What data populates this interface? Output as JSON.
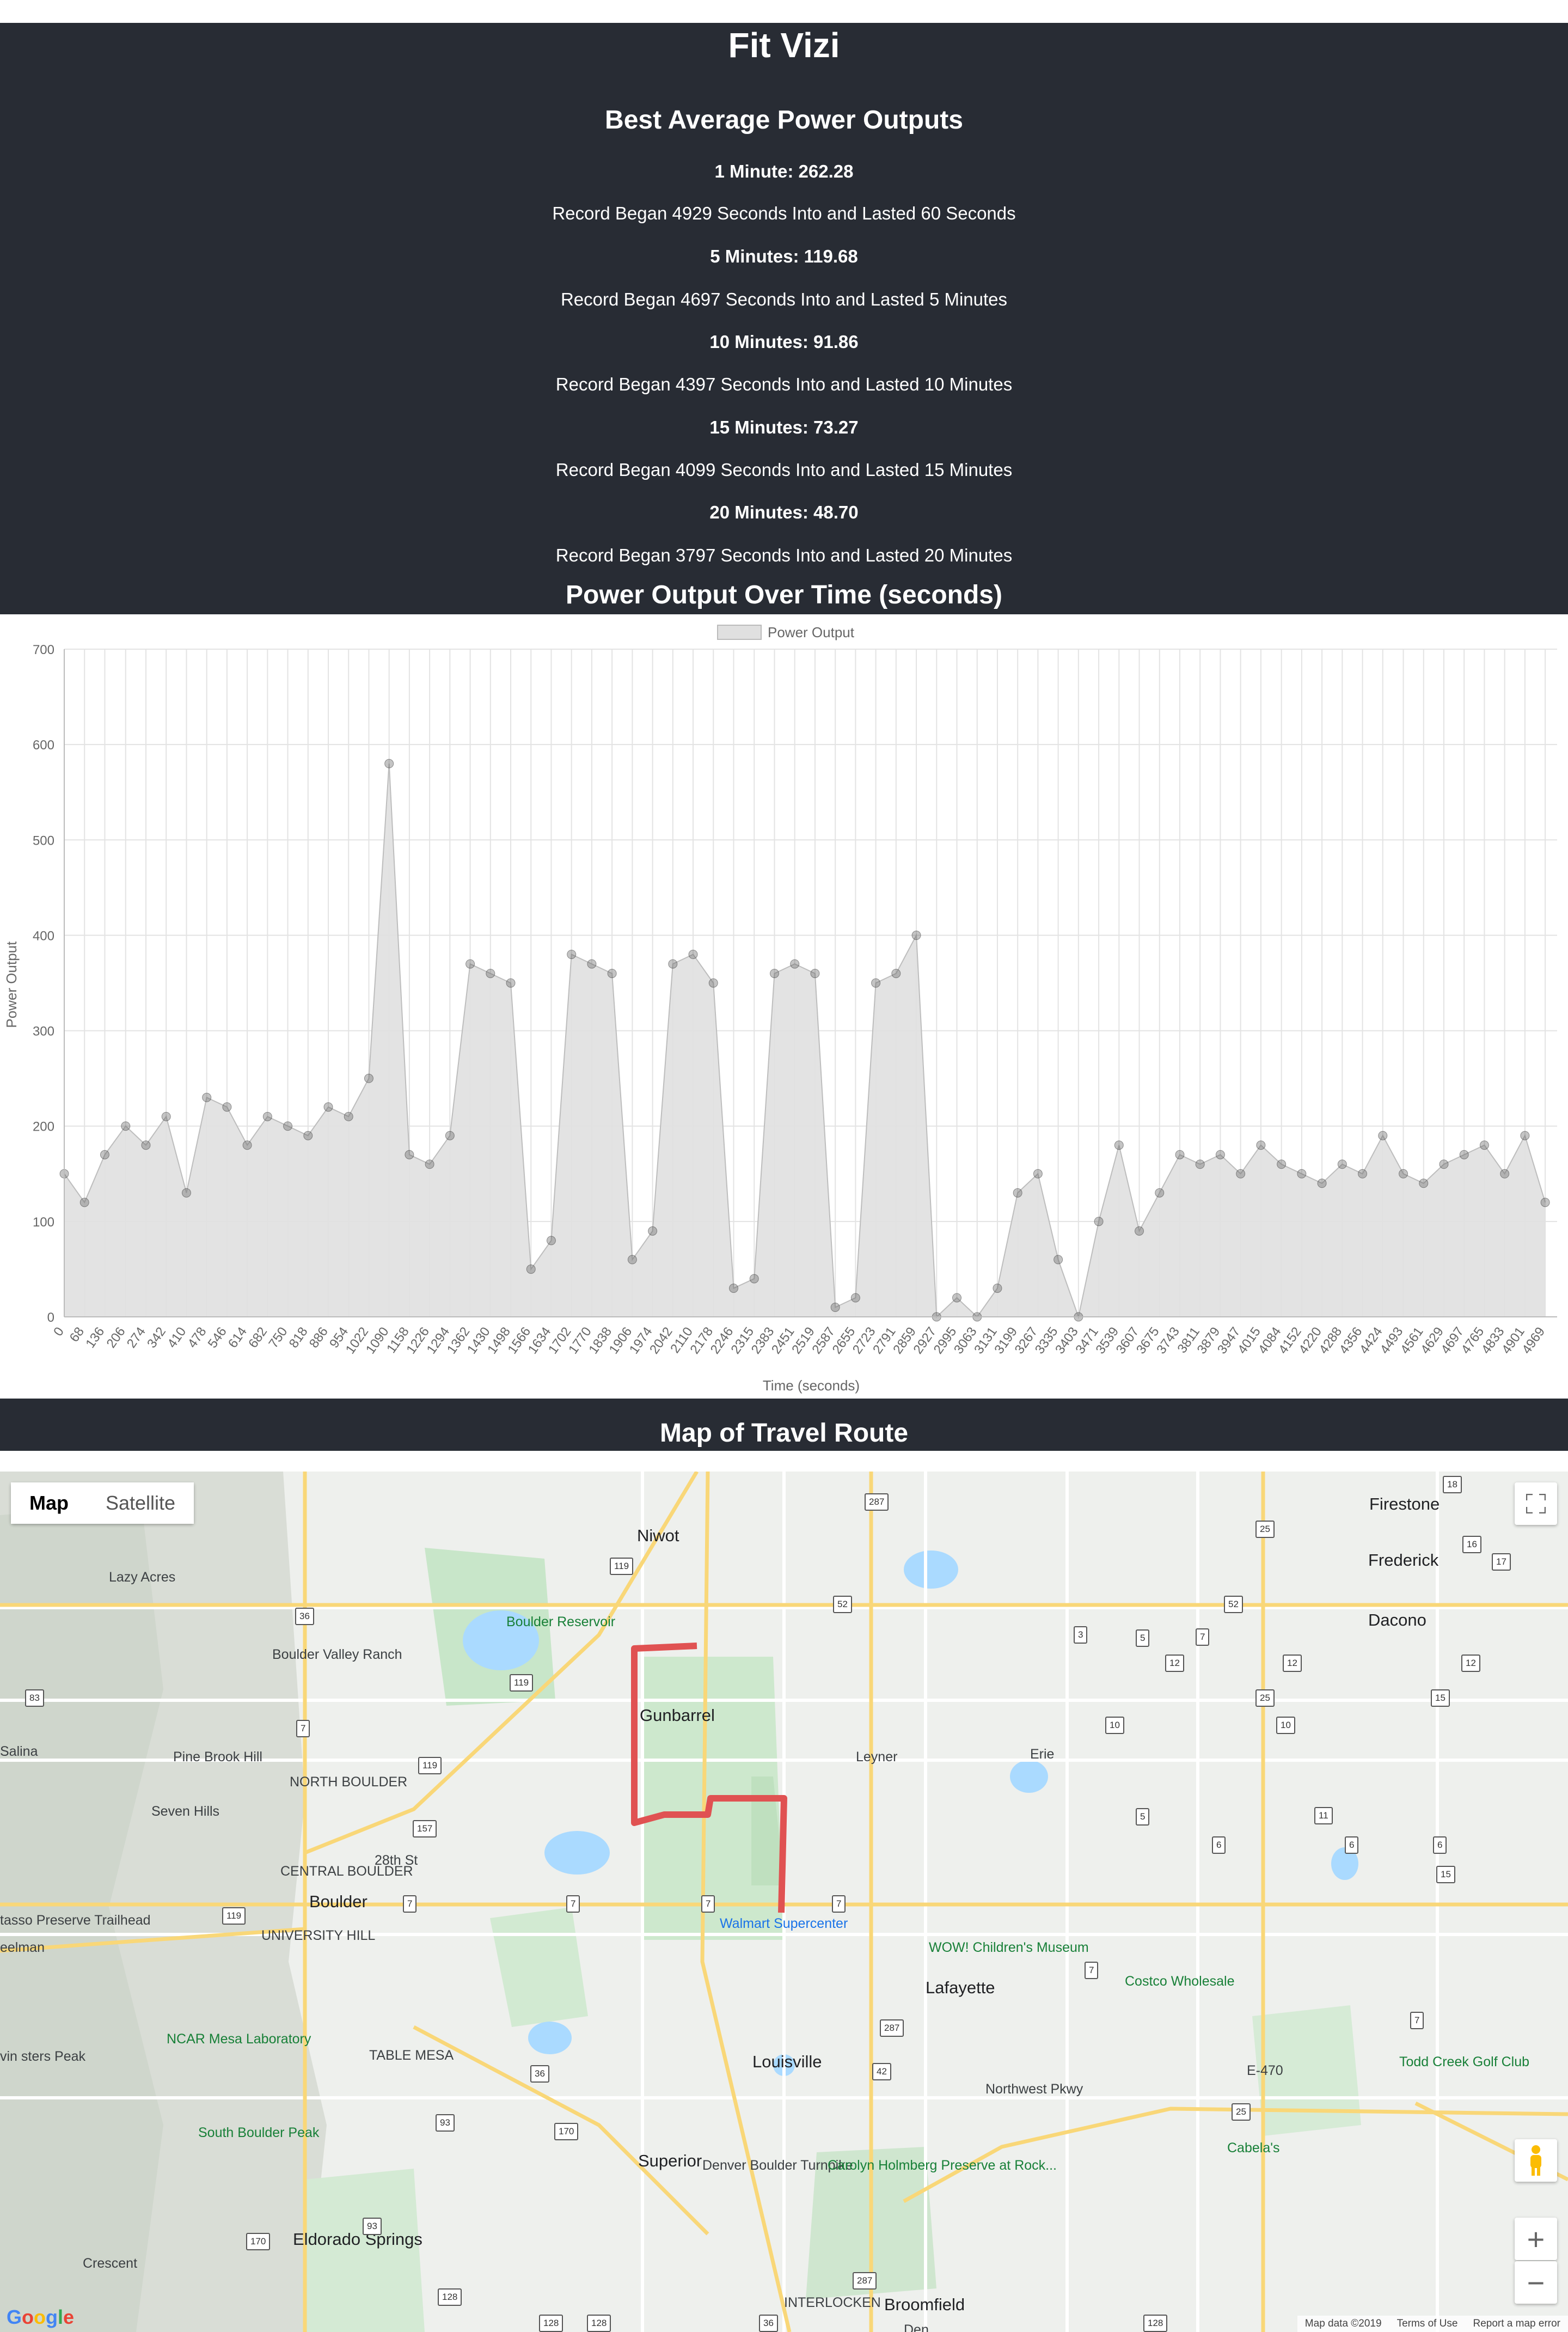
{
  "app_title": "Fit Vizi",
  "best_power": {
    "heading": "Best Average Power Outputs",
    "records": [
      {
        "title": "1 Minute: 262.28",
        "desc": "Record Began 4929 Seconds Into and Lasted 60 Seconds"
      },
      {
        "title": "5 Minutes: 119.68",
        "desc": "Record Began 4697 Seconds Into and Lasted 5 Minutes"
      },
      {
        "title": "10 Minutes: 91.86",
        "desc": "Record Began 4397 Seconds Into and Lasted 10 Minutes"
      },
      {
        "title": "15 Minutes: 73.27",
        "desc": "Record Began 4099 Seconds Into and Lasted 15 Minutes"
      },
      {
        "title": "20 Minutes: 48.70",
        "desc": "Record Began 3797 Seconds Into and Lasted 20 Minutes"
      }
    ]
  },
  "chart_heading": "Power Output Over Time (seconds)",
  "chart_data": {
    "type": "line",
    "title": "",
    "legend": "Power Output",
    "legend_position": "top",
    "xlabel": "Time (seconds)",
    "ylabel": "Power Output",
    "ylim": [
      0,
      700
    ],
    "yticks": [
      0,
      100,
      200,
      300,
      400,
      500,
      600,
      700
    ],
    "grid": true,
    "x_ticks": [
      0,
      68,
      136,
      206,
      274,
      342,
      410,
      478,
      546,
      614,
      682,
      750,
      818,
      886,
      954,
      1022,
      1090,
      1158,
      1226,
      1294,
      1362,
      1430,
      1498,
      1566,
      1634,
      1702,
      1770,
      1838,
      1906,
      1974,
      2042,
      2110,
      2178,
      2246,
      2315,
      2383,
      2451,
      2519,
      2587,
      2655,
      2723,
      2791,
      2859,
      2927,
      2995,
      3063,
      3131,
      3199,
      3267,
      3335,
      3403,
      3471,
      3539,
      3607,
      3675,
      3743,
      3811,
      3879,
      3947,
      4015,
      4084,
      4152,
      4220,
      4288,
      4356,
      4424,
      4493,
      4561,
      4629,
      4697,
      4765,
      4833,
      4901,
      4969
    ],
    "series": [
      {
        "name": "Power Output",
        "x": [
          0,
          68,
          136,
          206,
          274,
          342,
          410,
          478,
          546,
          614,
          682,
          750,
          818,
          886,
          954,
          1022,
          1090,
          1158,
          1226,
          1294,
          1362,
          1430,
          1498,
          1566,
          1634,
          1702,
          1770,
          1838,
          1906,
          1974,
          2042,
          2110,
          2178,
          2246,
          2315,
          2383,
          2451,
          2519,
          2587,
          2655,
          2723,
          2791,
          2859,
          2927,
          2995,
          3063,
          3131,
          3199,
          3267,
          3335,
          3403,
          3471,
          3539,
          3607,
          3675,
          3743,
          3811,
          3879,
          3947,
          4015,
          4084,
          4152,
          4220,
          4288,
          4356,
          4424,
          4493,
          4561,
          4629,
          4697,
          4765,
          4833,
          4901,
          4969
        ],
        "values": [
          150,
          120,
          170,
          200,
          180,
          210,
          130,
          230,
          220,
          180,
          210,
          200,
          190,
          220,
          210,
          250,
          580,
          170,
          160,
          190,
          370,
          360,
          350,
          50,
          80,
          380,
          370,
          360,
          60,
          90,
          370,
          380,
          350,
          30,
          40,
          360,
          370,
          360,
          10,
          20,
          350,
          360,
          400,
          0,
          20,
          0,
          30,
          130,
          150,
          60,
          0,
          100,
          180,
          90,
          130,
          170,
          160,
          170,
          150,
          180,
          160,
          150,
          140,
          160,
          150,
          190,
          150,
          140,
          160,
          170,
          180,
          150,
          190,
          120
        ]
      }
    ],
    "fill_color": "#e0e0e0",
    "point_color": "#555555"
  },
  "map": {
    "heading": "Map of Travel Route",
    "type_map": "Map",
    "type_satellite": "Satellite",
    "zoom_in": "+",
    "zoom_out": "−",
    "attribution": [
      "Map data ©2019",
      "Terms of Use",
      "Report a map error"
    ],
    "logo": "Google",
    "route_color": "#e05252",
    "places": [
      "Niwot",
      "Firestone",
      "Frederick",
      "Dacono",
      "Lazy Acres",
      "Boulder Reservoir",
      "Boulder Valley Ranch",
      "Gunbarrel",
      "Leyner",
      "Erie",
      "Pine Brook Hill",
      "NORTH BOULDER",
      "Seven Hills",
      "Salina",
      "CENTRAL BOULDER",
      "Boulder",
      "UNIVERSITY HILL",
      "tasso Preserve Trailhead",
      "eelman",
      "28th St",
      "Walmart Supercenter",
      "WOW! Children's Museum",
      "Lafayette",
      "Costco Wholesale",
      "NCAR Mesa Laboratory",
      "TABLE MESA",
      "Louisville",
      "Northwest Pkwy",
      "E-470",
      "Todd Creek Golf Club",
      "vin sters Peak",
      "South Boulder Peak",
      "Superior",
      "Denver Boulder Turnpike",
      "Carolyn Holmberg Preserve at Rock...",
      "Cabela's",
      "Eldorado Springs",
      "Crescent",
      "INTERLOCKEN",
      "Broomfield",
      "Den"
    ],
    "shields": [
      "287",
      "18",
      "25",
      "16",
      "17",
      "119",
      "52",
      "52",
      "36",
      "3",
      "5",
      "7",
      "12",
      "12",
      "12",
      "83",
      "119",
      "25",
      "15",
      "10",
      "10",
      "7",
      "119",
      "5",
      "11",
      "157",
      "6",
      "6",
      "6",
      "7",
      "7",
      "7",
      "7",
      "15",
      "119",
      "7",
      "7",
      "287",
      "42",
      "36",
      "287",
      "25",
      "93",
      "170",
      "170",
      "93",
      "128",
      "128",
      "36",
      "128",
      "128"
    ]
  }
}
